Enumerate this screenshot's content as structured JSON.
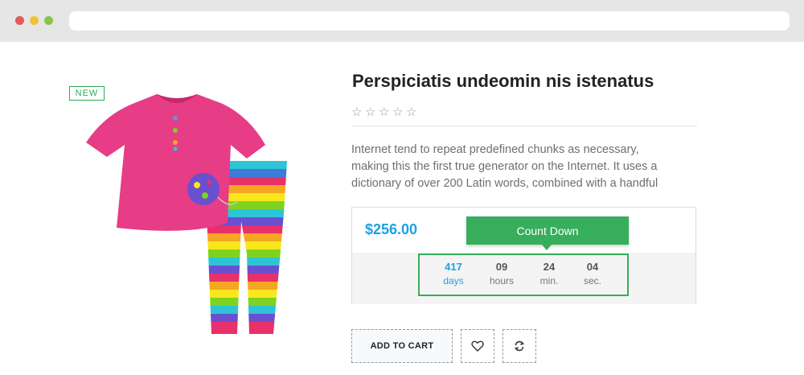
{
  "browser": {
    "url": ""
  },
  "product": {
    "badge": "NEW",
    "title": "Perspiciatis undeomin nis istenatus",
    "rating": 0,
    "rating_max": 5,
    "description_lines": [
      "Internet tend to repeat predefined chunks as necessary,",
      "making this the first true generator on the Internet. It uses a",
      "dictionary of over 200 Latin words, combined with a handful"
    ],
    "price": "$256.00"
  },
  "countdown": {
    "label": "Count Down",
    "days": {
      "value": "417",
      "label": "days"
    },
    "hours": {
      "value": "09",
      "label": "hours"
    },
    "minutes": {
      "value": "24",
      "label": "min."
    },
    "seconds": {
      "value": "04",
      "label": "sec."
    }
  },
  "actions": {
    "add_to_cart": "ADD TO CART",
    "wishlist_icon": "heart-icon",
    "compare_icon": "refresh-icon"
  },
  "colors": {
    "accent_green": "#36ae5c",
    "price_blue": "#1da1e2"
  }
}
